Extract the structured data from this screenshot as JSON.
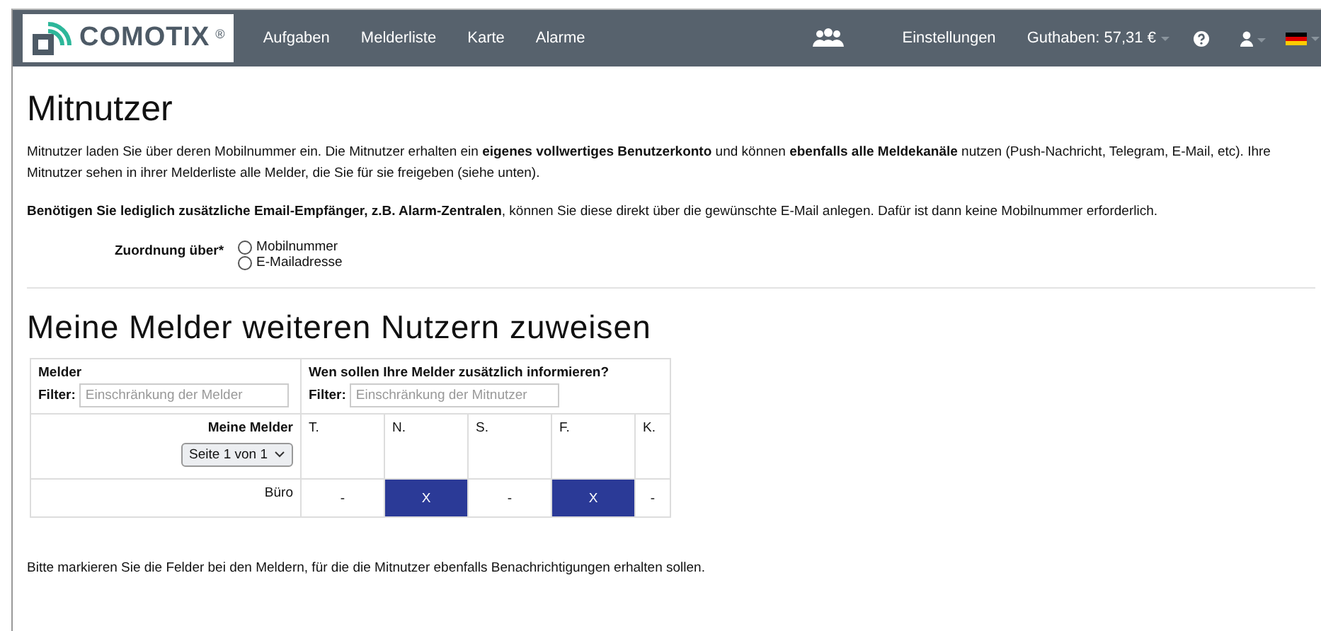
{
  "navbar": {
    "logo": "COMOTIX",
    "logo_mark": "®",
    "items": [
      "Aufgaben",
      "Melderliste",
      "Karte",
      "Alarme"
    ],
    "settings": "Einstellungen",
    "balance": "Guthaben: 57,31 €"
  },
  "title": "Mitnutzer",
  "intro": "Mitnutzer laden Sie über deren Mobilnummer ein. Die Mitnutzer erhalten ein **eigenes vollwertiges Benutzerkonto** und können **ebenfalls alle Meldekanäle** nutzen (Push-Nachricht, Telegram, E-Mail, etc). Ihre Mitnutzer sehen in ihrer Melderliste alle Melder, die Sie für sie freigeben (siehe unten).",
  "note": "**Benötigen Sie lediglich zusätzliche Email-Empfänger, z.B. Alarm-Zentralen**, können Sie diese direkt über die gewünschte E-Mail anlegen. Dafür ist dann keine Mobilnummer erforderlich.",
  "assignment": {
    "label": "Zuordnung über*",
    "options": [
      {
        "label": "Mobilnummer",
        "selected": false
      },
      {
        "label": "E-Mailadresse",
        "selected": false
      }
    ]
  },
  "section_title": "Meine Melder weiteren Nutzern zuweisen",
  "table": {
    "melder_header": "Melder",
    "melder_filter_label": "Filter:",
    "melder_filter_placeholder": "Einschränkung der Melder",
    "users_header": "Wen sollen Ihre Melder zusätzlich informieren?",
    "users_filter_label": "Filter:",
    "users_filter_placeholder": "Einschränkung der Mitnutzer",
    "my_melder": "Meine Melder",
    "page_select": "Seite 1 von 1",
    "columns": [
      "T.",
      "N.",
      "S.",
      "F.",
      "K."
    ],
    "rows": [
      {
        "name": "Büro",
        "cells": [
          {
            "text": "-",
            "selected": false
          },
          {
            "text": "X",
            "selected": true
          },
          {
            "text": "-",
            "selected": false
          },
          {
            "text": "X",
            "selected": true
          },
          {
            "text": "-",
            "selected": false
          }
        ]
      }
    ]
  },
  "hint": "Bitte markieren Sie die Felder bei den Meldern, für die die Mitnutzer ebenfalls Benachrichtigungen erhalten sollen."
}
